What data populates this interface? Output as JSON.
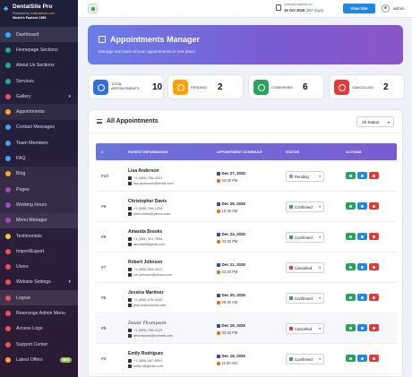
{
  "brand": {
    "name": "DentalSite Pro",
    "powered_prefix": "Powered by",
    "powered_by": "evilbrainhub.com",
    "tagline": "World's Fastest CMS"
  },
  "sidebar": {
    "items": [
      {
        "label": "Dashboard",
        "icon": "dashboard-icon",
        "color": "#29b6f6",
        "state": "active"
      },
      {
        "label": "Homepage Sections",
        "icon": "home-icon",
        "color": "#26a69a"
      },
      {
        "label": "About Us Sections",
        "icon": "info-icon",
        "color": "#26a69a"
      },
      {
        "label": "Services",
        "icon": "tooth-icon",
        "color": "#26a69a"
      },
      {
        "label": "Gallery",
        "icon": "image-icon",
        "color": "#ef5350",
        "chevron": true
      },
      {
        "label": "Appointments",
        "icon": "calendar-icon",
        "color": "#ffa726",
        "state": "light"
      },
      {
        "label": "Contact Messages",
        "icon": "envelope-icon",
        "color": "#42a5f5"
      },
      {
        "label": "Team Members",
        "icon": "users-icon",
        "color": "#42a5f5"
      },
      {
        "label": "FAQ",
        "icon": "question-icon",
        "color": "#42a5f5"
      },
      {
        "label": "Blog",
        "icon": "blog-icon",
        "color": "#ffa726",
        "state": "light"
      },
      {
        "label": "Pages",
        "icon": "file-icon",
        "color": "#ab47bc",
        "state": "light"
      },
      {
        "label": "Working Hours",
        "icon": "clock-icon",
        "color": "#ab47bc",
        "state": "light"
      },
      {
        "label": "Menu Manager",
        "icon": "bars-icon",
        "color": "#ab47bc",
        "state": "active"
      },
      {
        "label": "Testimonials",
        "icon": "star-icon",
        "color": "#ffca28"
      },
      {
        "label": "Import/Export",
        "icon": "exchange-icon",
        "color": "#ef5350"
      },
      {
        "label": "Users",
        "icon": "user-icon",
        "color": "#ef5350"
      },
      {
        "label": "Website Settings",
        "icon": "gear-icon",
        "color": "#ef5350",
        "chevron": true
      },
      {
        "label": "Logout",
        "icon": "logout-icon",
        "color": "#ef5350",
        "state": "active"
      },
      {
        "label": "Rearrange Admin Menu",
        "icon": "sort-icon",
        "color": "#ef5350"
      },
      {
        "label": "Access Logs",
        "icon": "shield-icon",
        "color": "#ef5350"
      },
      {
        "label": "Support Center",
        "icon": "support-icon",
        "color": "#ef5350"
      },
      {
        "label": "Latest Offers",
        "icon": "gift-icon",
        "color": "#ffa726",
        "badge": "NEW"
      }
    ]
  },
  "topbar": {
    "license_label": "License expires on",
    "license_date": "15 Oct 2026",
    "license_days": "(387 days)",
    "view_site": "View Site",
    "user": "admin"
  },
  "banner": {
    "title": "Appointments Manager",
    "subtitle": "Manage and track all your appointments in one place"
  },
  "stats": [
    {
      "label1": "Total",
      "label2": "Appointments",
      "value": "10",
      "color": "#2f6fe0",
      "icon": "calendar-icon"
    },
    {
      "label1": "Pending",
      "label2": "",
      "value": "2",
      "color": "#ffa000",
      "icon": "clock-icon"
    },
    {
      "label1": "Confirmed",
      "label2": "",
      "value": "6",
      "color": "#26a65b",
      "icon": "check-icon"
    },
    {
      "label1": "Cancelled",
      "label2": "",
      "value": "2",
      "color": "#e53935",
      "icon": "cancel-icon"
    }
  ],
  "panel": {
    "title": "All Appointments",
    "filter": "All Status"
  },
  "table": {
    "headers": [
      "#",
      "PATIENT INFORMATION",
      "APPOINTMENT SCHEDULE",
      "STATUS",
      "ACTIONS"
    ],
    "rows": [
      {
        "id": "#10",
        "name": "Lisa Anderson",
        "phone": "+1 (555) 765-4321",
        "email": "lisa.anderson@email.com",
        "date": "Dec 27, 2025",
        "time": "03:00 PM",
        "status": "Pending",
        "status_color": "#9e9e9e"
      },
      {
        "id": "#9",
        "name": "Christopher Davis",
        "phone": "+1 (555) 789-1234",
        "email": "chris.davis@yahoo.com",
        "date": "Dec 26, 2025",
        "time": "10:45 AM",
        "status": "Confirmed",
        "status_color": "#43a047"
      },
      {
        "id": "#8",
        "name": "Amanda Brooks",
        "phone": "+1 (555) 321-7654",
        "email": "abrooks@gmail.com",
        "date": "Dec 24, 2025",
        "time": "04:30 PM",
        "status": "Confirmed",
        "status_color": "#43a047"
      },
      {
        "id": "#7",
        "name": "Robert Johnson",
        "phone": "+1 (555) 654-3210",
        "email": "rob.johnson@icloud.com",
        "date": "Dec 21, 2025",
        "time": "02:30 PM",
        "status": "Cancelled",
        "status_color": "#e53935"
      },
      {
        "id": "#6",
        "name": "Jessica Martinez",
        "phone": "+1 (555) 876-5432",
        "email": "jess.m@outlook.com",
        "date": "Dec 20, 2025",
        "time": "09:30 AM",
        "status": "Confirmed",
        "status_color": "#43a047"
      },
      {
        "id": "#5",
        "name": "David Thompson",
        "phone": "+1 (555) 789-0123",
        "email": "dthompson@hotmail.com",
        "date": "Dec 19, 2025",
        "time": "03:45 PM",
        "status": "Cancelled",
        "status_color": "#e53935",
        "italic": true,
        "alt": true
      },
      {
        "id": "#4",
        "name": "Emily Rodriguez",
        "phone": "+1 (555) 567-8901",
        "email": "emily.r@gmail.com",
        "date": "Dec 18, 2025",
        "time": "11:00 AM",
        "status": "Confirmed",
        "status_color": "#43a047"
      }
    ]
  },
  "colors": {
    "view_action": "#26a65b",
    "edit_action": "#1e88e5",
    "delete_action": "#e53935"
  }
}
